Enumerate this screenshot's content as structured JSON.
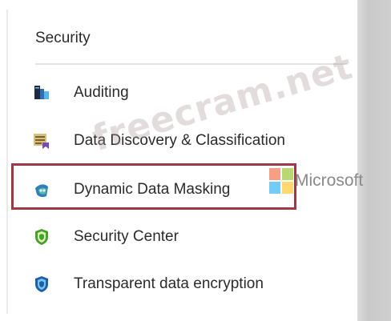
{
  "top_crop_text": "",
  "section": {
    "title": "Security"
  },
  "menu_items": [
    {
      "label": "Auditing",
      "icon": "auditing-icon"
    },
    {
      "label": "Data Discovery & Classification",
      "icon": "data-discovery-icon"
    },
    {
      "label": "Dynamic Data Masking",
      "icon": "data-masking-icon"
    },
    {
      "label": "Security Center",
      "icon": "security-center-shield-icon"
    },
    {
      "label": "Transparent data encryption",
      "icon": "encryption-shield-icon"
    }
  ],
  "highlight": {
    "color": "#9b3a44"
  },
  "overlay": {
    "microsoft_text": "Microsoft",
    "watermark_text": "freecram.net"
  },
  "colors": {
    "text": "#2b2b2b",
    "divider": "#e3e3e3",
    "ms_red": "#f25022",
    "ms_green": "#7fba00",
    "ms_blue": "#00a4ef",
    "ms_yellow": "#ffb900"
  }
}
